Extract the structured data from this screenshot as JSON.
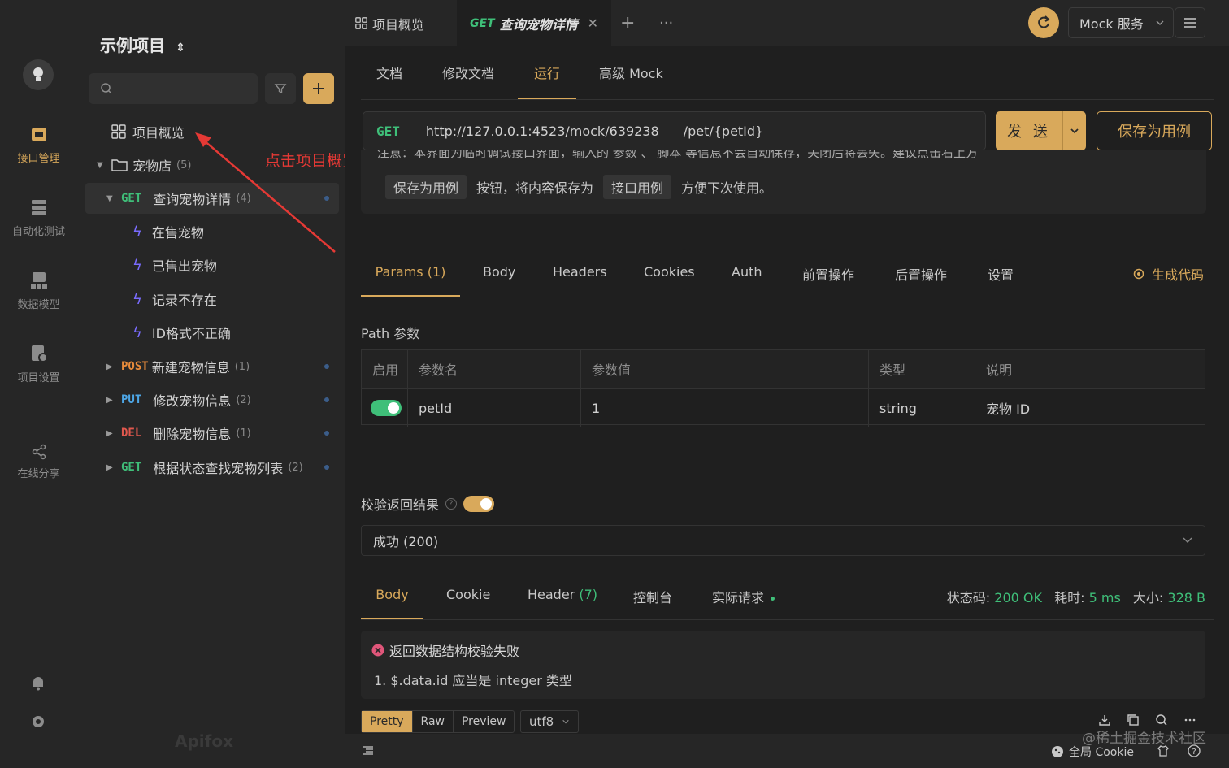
{
  "sidebar": {
    "project_title": "示例项目",
    "items": [
      {
        "label": "项目概览"
      },
      {
        "label": "宠物店",
        "count": "(5)"
      },
      {
        "method": "GET",
        "label": "查询宠物详情",
        "count": "(4)"
      },
      {
        "label": "在售宠物"
      },
      {
        "label": "已售出宠物"
      },
      {
        "label": "记录不存在"
      },
      {
        "label": "ID格式不正确"
      },
      {
        "method": "POST",
        "label": "新建宠物信息",
        "count": "(1)"
      },
      {
        "method": "PUT",
        "label": "修改宠物信息",
        "count": "(2)"
      },
      {
        "method": "DEL",
        "label": "删除宠物信息",
        "count": "(1)"
      },
      {
        "method": "GET",
        "label": "根据状态查找宠物列表",
        "count": "(2)"
      }
    ],
    "annotation": "点击项目概览",
    "brand": "Apifox"
  },
  "rail": {
    "items": [
      {
        "label": "接口管理"
      },
      {
        "label": "自动化测试"
      },
      {
        "label": "数据模型"
      },
      {
        "label": "项目设置"
      },
      {
        "label": "在线分享"
      }
    ]
  },
  "topbar": {
    "tab1": "项目概览",
    "tab2_method": "GET",
    "tab2_label": "查询宠物详情",
    "mock_service": "Mock 服务"
  },
  "subtabs": [
    "文档",
    "修改文档",
    "运行",
    "高级 Mock"
  ],
  "request": {
    "method": "GET",
    "base_url": "http://127.0.0.1:4523/mock/639238",
    "path": "/pet/{petId}",
    "send": "发 送",
    "save_case": "保存为用例"
  },
  "notice": {
    "line1": "注意：本界面为临时调试接口界面，输入的  参数  、 脚本  等信息不会自动保存，关闭后将丢失。建议点击右上方",
    "tag1": "保存为用例",
    "mid": "按钮，将内容保存为",
    "tag2": "接口用例",
    "end": "方便下次使用。"
  },
  "param_tabs": [
    "Params (1)",
    "Body",
    "Headers",
    "Cookies",
    "Auth",
    "前置操作",
    "后置操作",
    "设置"
  ],
  "gen_code": "生成代码",
  "path_params": {
    "title": "Path 参数",
    "headers": [
      "启用",
      "参数名",
      "参数值",
      "类型",
      "说明"
    ],
    "row": {
      "name": "petId",
      "value": "1",
      "type": "string",
      "desc": "宠物 ID"
    }
  },
  "validate": {
    "label": "校验返回结果",
    "selected": "成功 (200)"
  },
  "response_tabs": {
    "body": "Body",
    "cookie": "Cookie",
    "header": "Header",
    "header_count": "(7)",
    "console": "控制台",
    "actual": "实际请求"
  },
  "stats": {
    "status_label": "状态码:",
    "status_value": "200 OK",
    "time_label": "耗时:",
    "time_value": "5 ms",
    "size_label": "大小:",
    "size_value": "328 B"
  },
  "error": {
    "title": "返回数据结构校验失败",
    "detail": "1. $.data.id 应当是 integer 类型"
  },
  "format": {
    "options": [
      "Pretty",
      "Raw",
      "Preview"
    ],
    "encoding": "utf8"
  },
  "bottom": {
    "cookie": "全局 Cookie",
    "watermark": "@稀土掘金技术社区"
  },
  "colors": {
    "accent": "#d9a95b",
    "get": "#3fbf79",
    "post": "#e88b3b",
    "put": "#4da6e6",
    "del": "#e0584e"
  }
}
